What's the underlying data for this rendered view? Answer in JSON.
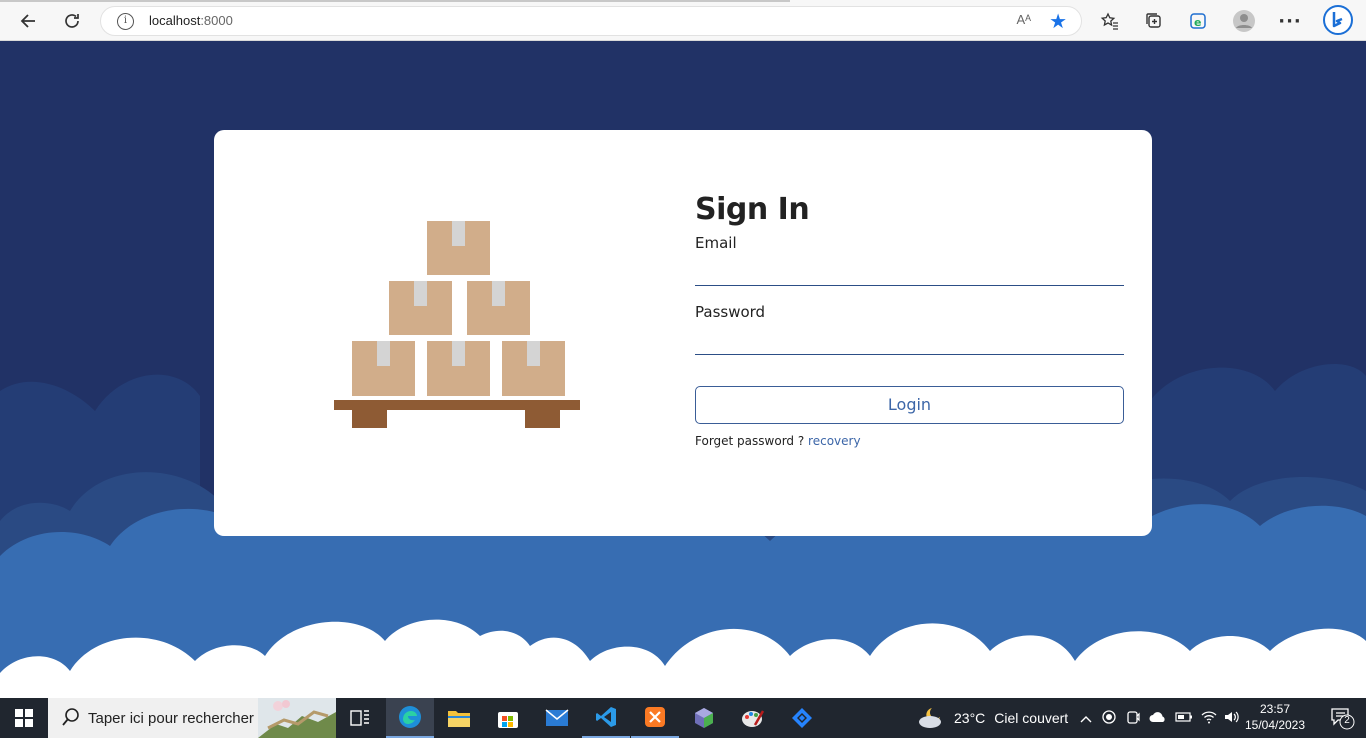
{
  "browser": {
    "url_host": "localhost",
    "url_port": ":8000",
    "read_aloud": "Aᴬ"
  },
  "signin": {
    "title": "Sign In",
    "email_label": "Email",
    "email_value": "",
    "password_label": "Password",
    "password_value": "",
    "login_label": "Login",
    "forget_text": "Forget password ?",
    "recovery_link": "recovery"
  },
  "taskbar": {
    "search_placeholder": "Taper ici pour rechercher",
    "weather_temp": "23°C",
    "weather_desc": "Ciel couvert",
    "time": "23:57",
    "date": "15/04/2023",
    "notifications": "2"
  },
  "colors": {
    "page_bg": "#213266",
    "cloud_mid": "#2a4a83",
    "cloud_front": "#376db2",
    "accent": "#3c66a8"
  }
}
